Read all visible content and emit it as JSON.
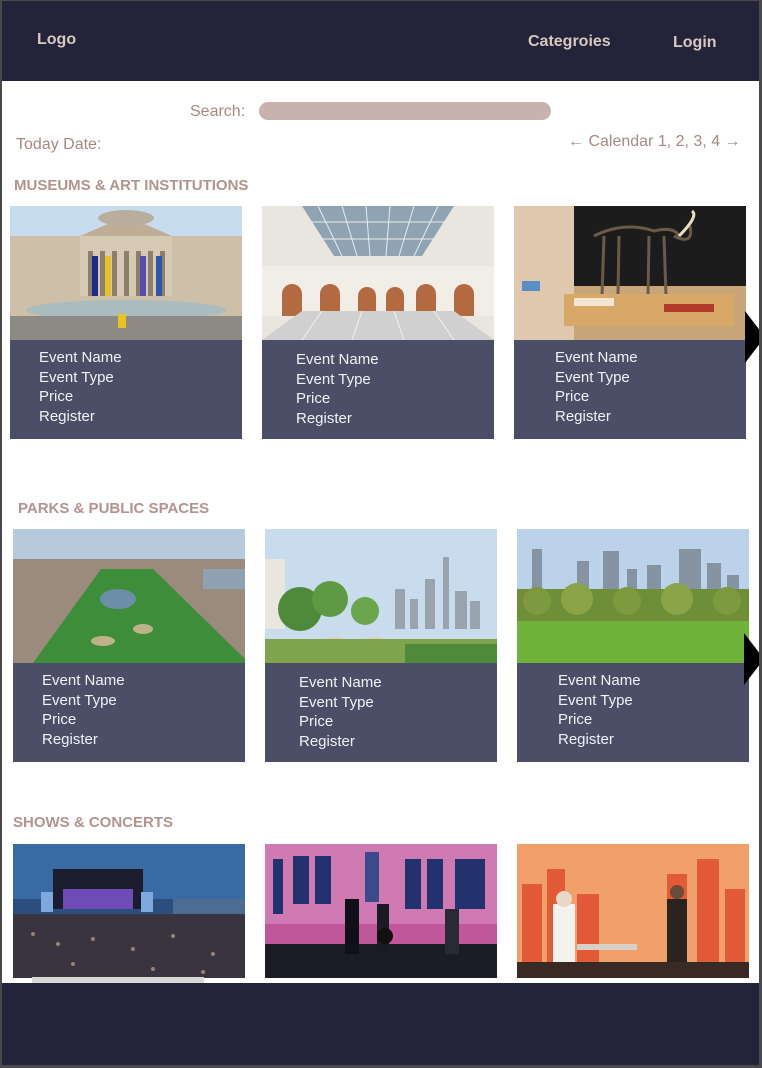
{
  "header": {
    "logo": "Logo",
    "categories": "Categroies",
    "login": "Login"
  },
  "search": {
    "label": "Search:",
    "placeholder": ""
  },
  "date": {
    "label": "Today Date:"
  },
  "calendar": {
    "text": "← Calendar 1, 2, 3, 4 →"
  },
  "sections": [
    {
      "title": "MUSEUMS & ART INSTITUTIONS",
      "cards": [
        {
          "name": "Event Name",
          "type": "Event Type",
          "price": "Price",
          "register": "Register"
        },
        {
          "name": "Event Name",
          "type": "Event Type",
          "price": "Price",
          "register": "Register"
        },
        {
          "name": "Event Name",
          "type": "Event Type",
          "price": "Price",
          "register": "Register"
        }
      ]
    },
    {
      "title": "PARKS & PUBLIC SPACES",
      "cards": [
        {
          "name": "Event Name",
          "type": "Event Type",
          "price": "Price",
          "register": "Register"
        },
        {
          "name": "Event Name",
          "type": "Event Type",
          "price": "Price",
          "register": "Register"
        },
        {
          "name": "Event Name",
          "type": "Event Type",
          "price": "Price",
          "register": "Register"
        }
      ]
    },
    {
      "title": "SHOWS & CONCERTS"
    }
  ],
  "colors": {
    "header": "#23233a",
    "card": "#4c4d67",
    "accent": "#b3938d",
    "search": "#c8b2ad"
  }
}
